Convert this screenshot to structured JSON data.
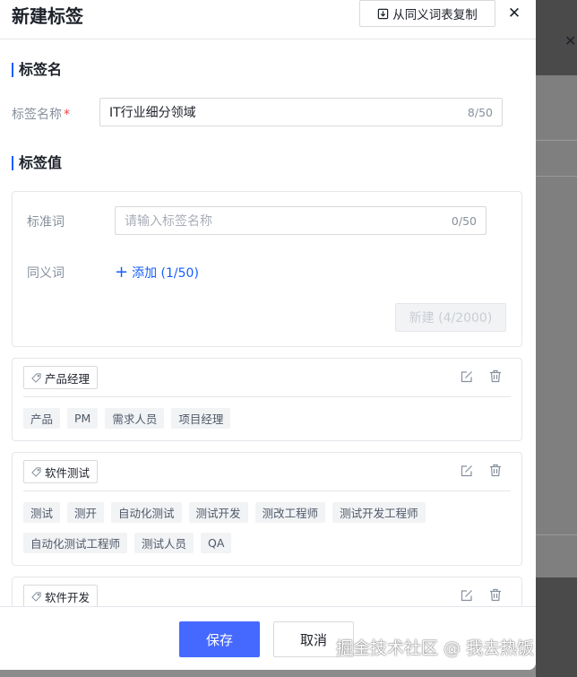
{
  "drawer": {
    "title": "新建标签",
    "copy_button": "从同义词表复制"
  },
  "tag_name_section": {
    "title": "标签名",
    "field_label": "标签名称",
    "required_mark": "*",
    "value": "IT行业细分领域",
    "count": "8/50"
  },
  "tag_value_section": {
    "title": "标签值",
    "standard_label": "标准词",
    "standard_placeholder": "请输入标签名称",
    "standard_count": "0/50",
    "synonym_label": "同义词",
    "add_label": "添加 (1/50)",
    "new_button": "新建 (4/2000)"
  },
  "cards": [
    {
      "name": "产品经理",
      "synonyms": [
        "产品",
        "PM",
        "需求人员",
        "项目经理"
      ]
    },
    {
      "name": "软件测试",
      "synonyms": [
        "测试",
        "测开",
        "自动化测试",
        "测试开发",
        "测改工程师",
        "测试开发工程师",
        "自动化测试工程师",
        "测试人员",
        "QA"
      ]
    },
    {
      "name": "软件开发",
      "synonyms": []
    }
  ],
  "footer": {
    "save_label": "保存",
    "cancel_label": "取消"
  },
  "watermark": "掘金技术社区 @ 我去热饭",
  "colors": {
    "primary": "#4569ff",
    "accent_bar": "#165dff",
    "required": "#f53f3f"
  }
}
